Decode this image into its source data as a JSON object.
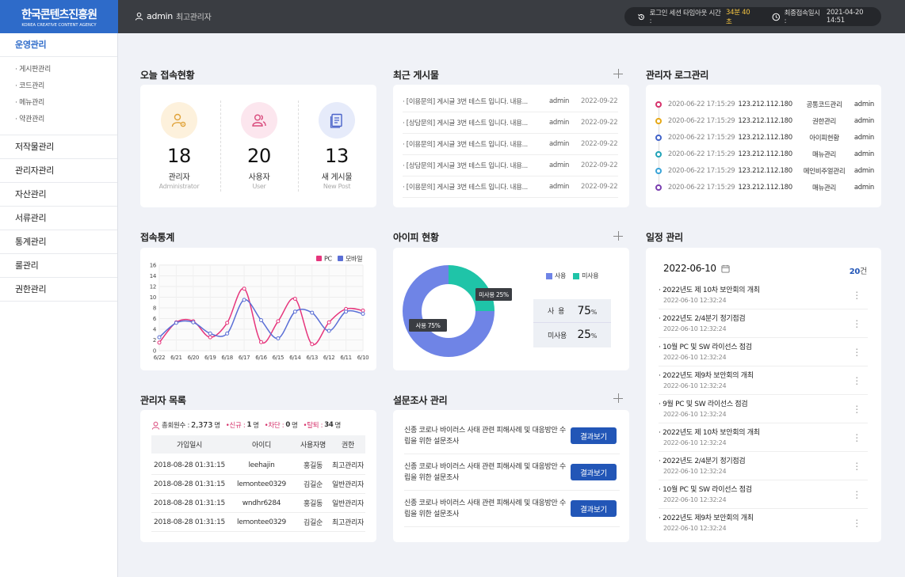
{
  "header": {
    "logo_kr": "한국콘텐츠진흥원",
    "logo_en": "KOREA CREATIVE CONTENT AGENCY",
    "user_name": "admin",
    "user_role": "최고관리자",
    "session_label": "로그인 세션 타임아웃 시간 :",
    "session_time": "34분 40초",
    "last_login_label": "최종접속일시 :",
    "last_login": "2021-04-20 14:51"
  },
  "sidebar": {
    "items": [
      {
        "label": "운영관리"
      },
      {
        "label": "저작물관리"
      },
      {
        "label": "관리자관리"
      },
      {
        "label": "자산관리"
      },
      {
        "label": "서류관리"
      },
      {
        "label": "통계관리"
      },
      {
        "label": "룰관리"
      },
      {
        "label": "권한관리"
      }
    ],
    "sub_items": [
      {
        "label": "· 게시판관리"
      },
      {
        "label": "· 코드관리"
      },
      {
        "label": "· 메뉴관리"
      },
      {
        "label": "· 약관관리"
      }
    ]
  },
  "today": {
    "title": "오늘 접속현황",
    "stats": [
      {
        "num": "18",
        "label": "관리자",
        "en": "Administrator",
        "color": "#fdf1dc",
        "icon": "admin-gear-icon"
      },
      {
        "num": "20",
        "label": "사용자",
        "en": "User",
        "color": "#fce6ee",
        "icon": "users-icon"
      },
      {
        "num": "13",
        "label": "새 게시물",
        "en": "New Post",
        "color": "#e6ebfa",
        "icon": "document-icon"
      }
    ]
  },
  "posts": {
    "title": "최근 게시물",
    "rows": [
      {
        "title": "· [이용문의] 게시글 3번 테스트 입니다. 내용...",
        "author": "admin",
        "date": "2022-09-22"
      },
      {
        "title": "· [상담문의] 게시글 3번 테스트 입니다. 내용...",
        "author": "admin",
        "date": "2022-09-22"
      },
      {
        "title": "· [이용문의] 게시글 3번 테스트 입니다. 내용...",
        "author": "admin",
        "date": "2022-09-22"
      },
      {
        "title": "· [상담문의] 게시글 3번 테스트 입니다. 내용...",
        "author": "admin",
        "date": "2022-09-22"
      },
      {
        "title": "· [이용문의] 게시글 3번 테스트 입니다. 내용...",
        "author": "admin",
        "date": "2022-09-22"
      }
    ]
  },
  "adminlog": {
    "title": "관리자 로그관리",
    "rows": [
      {
        "ts": "2020-06-22 17:15:29",
        "ip": "123.212.112.180",
        "menu": "공통코드관리",
        "user": "admin",
        "color": "#d6336c"
      },
      {
        "ts": "2020-06-22 17:15:29",
        "ip": "123.212.112.180",
        "menu": "권한관리",
        "user": "admin",
        "color": "#e6a817"
      },
      {
        "ts": "2020-06-22 17:15:29",
        "ip": "123.212.112.180",
        "menu": "아이피현황",
        "user": "admin",
        "color": "#4263c9"
      },
      {
        "ts": "2020-06-22 17:15:29",
        "ip": "123.212.112.180",
        "menu": "매뉴관리",
        "user": "admin",
        "color": "#22a3b8"
      },
      {
        "ts": "2020-06-22 17:15:29",
        "ip": "123.212.112.180",
        "menu": "메인비주얼관리",
        "user": "admin",
        "color": "#3aa4d8"
      },
      {
        "ts": "2020-06-22 17:15:29",
        "ip": "123.212.112.180",
        "menu": "매뉴관리",
        "user": "admin",
        "color": "#7b3fb0"
      }
    ]
  },
  "access_stats": {
    "title": "접속통계"
  },
  "ip_status": {
    "title": "아이피 현황",
    "legend_used": "사용",
    "legend_unused": "미사용",
    "used_label": "사  용",
    "used_pct": "75",
    "unused_label": "미사용",
    "unused_pct": "25",
    "pct_unit": "%",
    "tip_used": "사용 75%",
    "tip_unused": "미사용 25%",
    "color_used": "#6f84e6",
    "color_unused": "#1fc4a8"
  },
  "schedule": {
    "title": "일정 관리",
    "date": "2022-06-10",
    "count_num": "20",
    "count_unit": "건",
    "items": [
      {
        "title": "· 2022년도 제 10차 보안회의 개최",
        "date": "2022-06-10 12:32:24"
      },
      {
        "title": "· 2022년도 2/4분기 정기점검",
        "date": "2022-06-10 12:32:24"
      },
      {
        "title": "· 10월 PC 및 SW 라이선스 점검",
        "date": "2022-06-10 12:32:24"
      },
      {
        "title": "· 2022년도 제9차 보안회의 개최",
        "date": "2022-06-10 12:32:24"
      },
      {
        "title": "· 9월 PC 및 SW 라이선스 점검",
        "date": "2022-06-10 12:32:24"
      },
      {
        "title": "· 2022년도 제 10차 보안회의 개최",
        "date": "2022-06-10 12:32:24"
      },
      {
        "title": "· 2022년도 2/4분기 정기점검",
        "date": "2022-06-10 12:32:24"
      },
      {
        "title": "· 10월 PC 및 SW 라이선스 점검",
        "date": "2022-06-10 12:32:24"
      },
      {
        "title": "· 2022년도 제9차 보안회의 개최",
        "date": "2022-06-10 12:32:24"
      }
    ]
  },
  "admin_list": {
    "title": "관리자 목록",
    "total_label": "총회원수 :",
    "total": "2,373",
    "total_unit": "명",
    "new_label": "•신규 :",
    "new_val": "1",
    "block_label": "•차단 :",
    "block_val": "0",
    "leave_label": "•탈퇴 :",
    "leave_val": "34",
    "unit": "명",
    "headers": [
      "가입일시",
      "아이디",
      "사용자명",
      "권한"
    ],
    "rows": [
      [
        "2018-08-28  01:31:15",
        "leehajin",
        "홍길동",
        "최고관리자"
      ],
      [
        "2018-08-28  01:31:15",
        "lemontee0329",
        "김길순",
        "일반관리자"
      ],
      [
        "2018-08-28  01:31:15",
        "wndhr6284",
        "홍길동",
        "일반관리자"
      ],
      [
        "2018-08-28  01:31:15",
        "lemontee0329",
        "김길순",
        "최고관리자"
      ]
    ]
  },
  "survey": {
    "title": "설문조사 관리",
    "button": "결과보기",
    "rows": [
      {
        "title": "신종 코로나 바이러스 사태 관련 피해사례 및 대응방안 수립을 위한 설문조사"
      },
      {
        "title": "신종 코로나 바이러스 사태 관련 피해사례 및 대응방안 수립을 위한 설문조사"
      },
      {
        "title": "신종 코로나 바이러스 사태 관련 피해사례 및 대응방안 수립을 위한 설문조사"
      }
    ]
  },
  "chart_data": {
    "type": "line",
    "categories": [
      "6/22",
      "6/21",
      "6/20",
      "6/19",
      "6/18",
      "6/17",
      "6/16",
      "6/15",
      "6/14",
      "6/13",
      "6/12",
      "6/11",
      "6/10"
    ],
    "series": [
      {
        "name": "PC",
        "values": [
          1.5,
          5.3,
          5.5,
          2.5,
          5.2,
          11.6,
          1.6,
          5.5,
          9.7,
          1.2,
          5.3,
          7.8,
          7.5
        ],
        "color": "#e6357c"
      },
      {
        "name": "모바일",
        "values": [
          2.5,
          5.2,
          5.3,
          3.2,
          3.2,
          9.5,
          5.7,
          2.3,
          7.3,
          7.1,
          3.7,
          7.3,
          6.9
        ],
        "color": "#5b6fd6"
      }
    ],
    "yticks": [
      "0",
      "2",
      "4",
      "6",
      "8",
      "10",
      "12",
      "14",
      "16"
    ],
    "ylim": [
      0,
      16
    ],
    "grid": true,
    "legend": "top-right"
  }
}
